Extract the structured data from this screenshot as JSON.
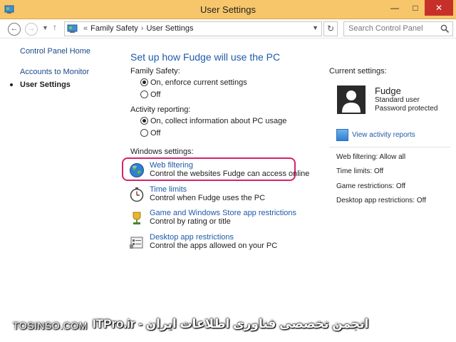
{
  "window": {
    "title": "User Settings",
    "minimize_glyph": "—",
    "maximize_glyph": "□",
    "close_glyph": "✕"
  },
  "address": {
    "crumbs": [
      "Family Safety",
      "User Settings"
    ],
    "prefix_glyph": "«",
    "separator": "›",
    "search_placeholder": "Search Control Panel"
  },
  "icons": {
    "back": "back-arrow-icon",
    "forward": "forward-arrow-icon",
    "history": "chevron-down-icon",
    "up": "up-arrow-icon",
    "refresh": "refresh-icon",
    "search": "search-icon",
    "control_panel": "control-panel-icon",
    "web_filtering": "globe-icon",
    "time_limits": "stopwatch-icon",
    "game_restrictions": "trophy-icon",
    "desktop_app_restrictions": "app-list-icon",
    "activity_reports": "report-icon",
    "user": "user-silhouette-icon"
  },
  "sidebar": {
    "items": [
      {
        "label": "Control Panel Home",
        "current": false
      },
      {
        "label": "Accounts to Monitor",
        "current": false
      },
      {
        "label": "User Settings",
        "current": true
      }
    ]
  },
  "main": {
    "title": "Set up how Fudge will use the PC",
    "family_safety": {
      "label": "Family Safety:",
      "options": [
        {
          "label": "On, enforce current settings",
          "selected": true
        },
        {
          "label": "Off",
          "selected": false
        }
      ]
    },
    "activity_reporting": {
      "label": "Activity reporting:",
      "options": [
        {
          "label": "On, collect information about PC usage",
          "selected": true
        },
        {
          "label": "Off",
          "selected": false
        }
      ]
    },
    "windows_settings": {
      "label": "Windows settings:",
      "items": [
        {
          "link": "Web filtering",
          "desc": "Control the websites Fudge can access online",
          "highlighted": true
        },
        {
          "link": "Time limits",
          "desc": "Control when Fudge uses the PC",
          "highlighted": false
        },
        {
          "link": "Game and Windows Store app restrictions",
          "desc": "Control by rating or title",
          "highlighted": false
        },
        {
          "link": "Desktop app restrictions",
          "desc": "Control the apps allowed on your PC",
          "highlighted": false
        }
      ]
    }
  },
  "current": {
    "label": "Current settings:",
    "user_name": "Fudge",
    "user_type": "Standard user",
    "user_password": "Password protected",
    "view_reports": "View activity reports",
    "statuses": [
      "Web filtering:  Allow all",
      "Time limits:  Off",
      "Game restrictions:  Off",
      "Desktop app restrictions:  Off"
    ]
  },
  "watermark": {
    "left": "TOSINSO.COM",
    "right": "ITPro.ir - انجمن تخصصی فناوری اطلاعات ایران"
  },
  "colors": {
    "titlebar": "#f7c66a",
    "close_button": "#c7302a",
    "link": "#1e5aa8",
    "highlight": "#d4246a"
  }
}
